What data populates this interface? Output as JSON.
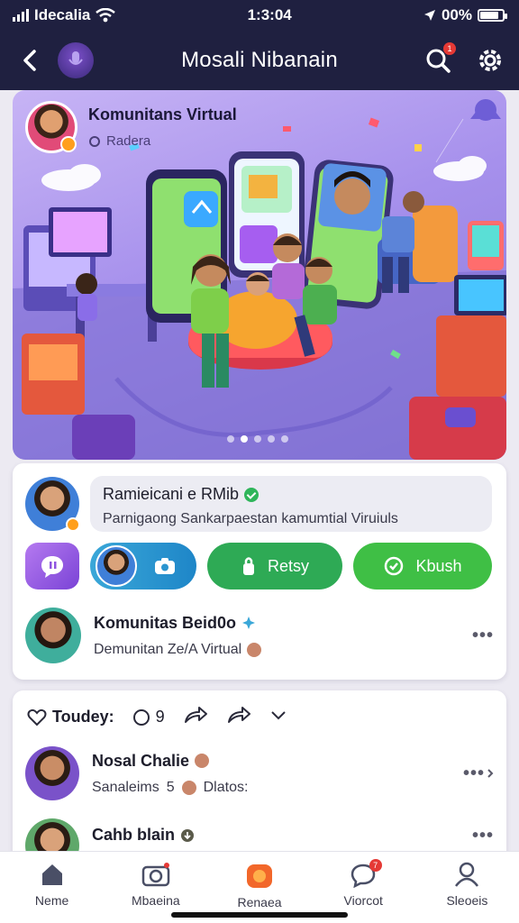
{
  "status_bar": {
    "carrier": "Idecalia",
    "time": "1:3:04",
    "battery": "00%",
    "battery_level": 0.85
  },
  "header": {
    "title": "Mosali Nibanain",
    "notification_count": "1"
  },
  "hero": {
    "title": "Komunitans Virtual",
    "subtitle": "Radera",
    "slide_count": 5,
    "active_slide": 1
  },
  "post": {
    "title": "Ramieicani e RMib",
    "subtitle": "Parnigaong Sankarpaestan kamumtial Viruiuls"
  },
  "actions": {
    "reply_label": "Retsy",
    "share_label": "Kbush"
  },
  "community": {
    "title": "Komunitas Beid0o",
    "subtitle": "Demunitan Ze/A Virtual"
  },
  "feed": {
    "label": "Toudey:",
    "comment_count": "9",
    "items": [
      {
        "title": "Nosal Chalie",
        "subtitle": "Sanaleims",
        "count": "5",
        "extra": "Dlatos:"
      },
      {
        "title": "Cahb blain",
        "subtitle": "",
        "count": "",
        "extra": ""
      }
    ]
  },
  "tabs": [
    {
      "label": "Neme",
      "icon": "home-icon"
    },
    {
      "label": "Mbaeina",
      "icon": "camera-icon"
    },
    {
      "label": "Renaea",
      "icon": "orange-bag-icon"
    },
    {
      "label": "Viorcot",
      "icon": "chat-icon",
      "badge": "7"
    },
    {
      "label": "Sleoeis",
      "icon": "profile-icon"
    }
  ],
  "colors": {
    "header_bg": "#1f2040",
    "accent_purple": "#7a43d6",
    "accent_blue": "#1e86c8",
    "accent_green": "#2eaa55",
    "badge_red": "#e53935"
  }
}
